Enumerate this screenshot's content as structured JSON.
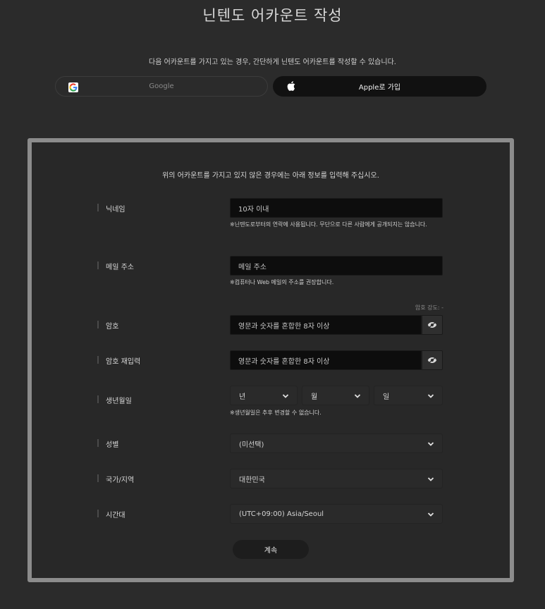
{
  "header": {
    "title": "닌텐도 어카운트 작성"
  },
  "sso": {
    "intro": "다음 어카운트를 가지고 있는 경우, 간단하게 닌텐도 어카운트를 작성할 수 있습니다.",
    "google_label": "Google",
    "apple_label": "Apple로 가입"
  },
  "form": {
    "intro": "위의 어카운트를 가지고 있지 않은 경우에는 아래 정보를 입력해 주십시오.",
    "nickname": {
      "label": "닉네임",
      "placeholder": "10자 이내",
      "hint": "※닌텐도로부터의 연락에 사용됩니다. 무단으로 다른 사람에게 공개되지는 않습니다."
    },
    "email": {
      "label": "메일 주소",
      "placeholder": "메일 주소",
      "hint": "※컴퓨터나 Web 메일의 주소를 권장합니다."
    },
    "password": {
      "strength": "암호 강도: -",
      "label": "암호",
      "placeholder": "영문과 숫자를 혼합한 8자 이상"
    },
    "password_confirm": {
      "label": "암호 재입력",
      "placeholder": "영문과 숫자를 혼합한 8자 이상"
    },
    "birthday": {
      "label": "생년월일",
      "year": "년",
      "month": "월",
      "day": "일",
      "hint": "※생년월일은 추후 변경할 수 없습니다."
    },
    "gender": {
      "label": "성별",
      "value": "(미선택)"
    },
    "country": {
      "label": "국가/지역",
      "value": "대한민국"
    },
    "timezone": {
      "label": "시간대",
      "value": "(UTC+09:00) Asia/Seoul"
    },
    "submit_label": "계속"
  }
}
